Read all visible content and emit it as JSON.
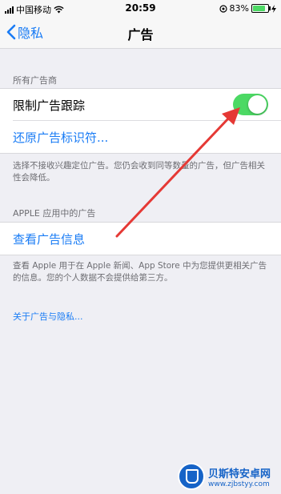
{
  "status_bar": {
    "carrier": "中国移动",
    "time": "20:59",
    "battery_percent": "83%",
    "battery_level": 0.83,
    "icons": [
      "signal-icon",
      "wifi-icon",
      "location-lock-icon",
      "battery-icon",
      "charging-icon"
    ]
  },
  "nav": {
    "back_label": "隐私",
    "title": "广告"
  },
  "section1": {
    "header": "所有广告商",
    "limit_tracking_label": "限制广告跟踪",
    "limit_tracking_on": true,
    "reset_label": "还原广告标识符...",
    "footer": "选择不接收兴趣定位广告。您仍会收到同等数量的广告，但广告相关性会降低。"
  },
  "section2": {
    "header": "APPLE 应用中的广告",
    "view_ad_info_label": "查看广告信息",
    "footer": "查看 Apple 用于在 Apple 新闻、App Store 中为您提供更相关广告的信息。您的个人数据不会提供给第三方。"
  },
  "about_link": "关于广告与隐私...",
  "watermark": {
    "title": "贝斯特安卓网",
    "url": "www.zjbstyy.com"
  },
  "colors": {
    "accent_blue": "#1a7cf5",
    "toggle_green": "#4cd964",
    "arrow_red": "#e53935",
    "background": "#efeff4"
  }
}
